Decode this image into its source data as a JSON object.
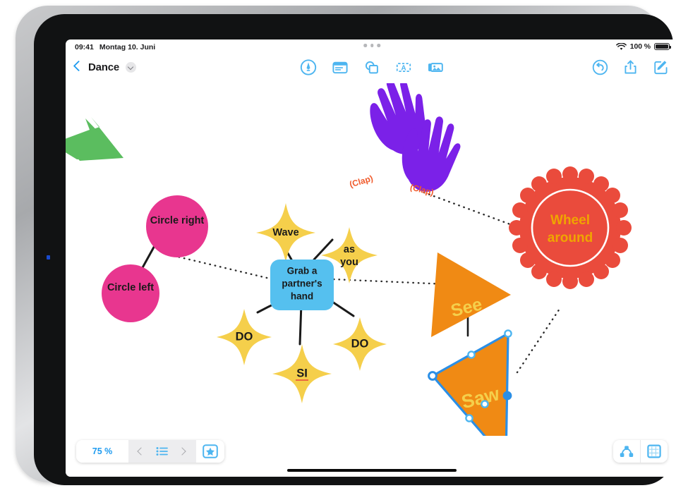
{
  "status_bar": {
    "time": "09:41",
    "date": "Montag 10. Juni",
    "wifi_icon": "wifi-icon",
    "battery_percent": "100 %",
    "battery_icon": "battery-icon",
    "multitask_icon": "multitask-dots-icon"
  },
  "toolbar": {
    "back_icon": "back-chevron-icon",
    "document_title": "Dance",
    "title_chevron_icon": "chevron-down-icon",
    "center_tools": [
      {
        "name": "markup-pen-icon",
        "label": "Markup"
      },
      {
        "name": "note-card-icon",
        "label": "Note"
      },
      {
        "name": "shapes-icon",
        "label": "Shapes"
      },
      {
        "name": "text-box-icon",
        "label": "Text Box"
      },
      {
        "name": "media-photos-icon",
        "label": "Media"
      }
    ],
    "right_tools": [
      {
        "name": "undo-icon",
        "label": "Undo"
      },
      {
        "name": "share-icon",
        "label": "Share"
      },
      {
        "name": "compose-icon",
        "label": "Compose"
      }
    ]
  },
  "bottom_bar": {
    "zoom_level": "75 %",
    "prev_icon": "chevron-left-icon",
    "list_icon": "list-icon",
    "next_icon": "chevron-right-icon",
    "star_icon": "star-in-box-icon",
    "node_icon": "node-tree-icon",
    "canvas_icon": "canvas-grid-icon",
    "home_indicator": "home-indicator"
  },
  "colors": {
    "accent_blue": "#1e9bf0",
    "pink": "#e8368f",
    "yellow": "#f5cf4b",
    "orange": "#f08a14",
    "red": "#ea4b3c",
    "purple": "#7b21e8",
    "green": "#5bbd5f",
    "node_blue": "#55c0ef",
    "star_text_yellow": "#f5cf4b",
    "clap_text": "#f05a2b",
    "wheel_text": "#f0a500",
    "selection_blue": "#2b8fe6"
  },
  "canvas": {
    "shapes": [
      {
        "name": "green-arrow-shape",
        "label": "",
        "type": "arrow",
        "color": "#5bbd5f"
      },
      {
        "name": "pink-circle-right",
        "label": "Circle right",
        "type": "circle",
        "color": "#e8368f",
        "text_color": "#1a1a1a"
      },
      {
        "name": "pink-circle-left",
        "label": "Circle left",
        "type": "circle",
        "color": "#e8368f",
        "text_color": "#1a1a1a"
      },
      {
        "name": "purple-hands-shape",
        "label": "(Clap)",
        "label2": "(Clap)",
        "type": "hands",
        "color": "#7b21e8",
        "text_color": "#f05a2b"
      },
      {
        "name": "star-wave",
        "label": "Wave",
        "type": "star",
        "color": "#f5cf4b",
        "text_color": "#1a1a1a"
      },
      {
        "name": "star-as-you",
        "label": "as you",
        "type": "star",
        "color": "#f5cf4b",
        "text_color": "#1a1a1a"
      },
      {
        "name": "center-node-grab-partners-hand",
        "label": "Grab a partner's hand",
        "type": "rounded-rect",
        "color": "#55c0ef",
        "text_color": "#1a1a1a"
      },
      {
        "name": "star-do-left",
        "label": "DO",
        "type": "star",
        "color": "#f5cf4b",
        "text_color": "#1a1a1a"
      },
      {
        "name": "star-si",
        "label": "SI",
        "type": "star",
        "color": "#f5cf4b",
        "text_color": "#1a1a1a",
        "spellcheck_underline": true
      },
      {
        "name": "star-do-right",
        "label": "DO",
        "type": "star",
        "color": "#f5cf4b",
        "text_color": "#1a1a1a"
      },
      {
        "name": "triangle-see",
        "label": "See",
        "type": "triangle",
        "color": "#f08a14",
        "text_color": "#f5cf4b"
      },
      {
        "name": "triangle-saw",
        "label": "Saw",
        "type": "triangle",
        "color": "#f08a14",
        "text_color": "#f5cf4b",
        "selected": true
      },
      {
        "name": "red-badge-wheel-around",
        "label": "Wheel around",
        "type": "scalloped-badge",
        "color": "#ea4b3c",
        "text_color": "#f0a500"
      }
    ],
    "labels": {
      "circle_right": "Circle right",
      "circle_left": "Circle left",
      "clap_1": "(Clap)",
      "clap_2": "(Clap)",
      "wave": "Wave",
      "as_you_1": "as",
      "as_you_2": "you",
      "grab_1": "Grab a",
      "grab_2": "partner's",
      "grab_3": "hand",
      "do_left": "DO",
      "si": "SI",
      "do_right": "DO",
      "see": "See",
      "saw": "Saw",
      "wheel_1": "Wheel",
      "wheel_2": "around"
    }
  }
}
